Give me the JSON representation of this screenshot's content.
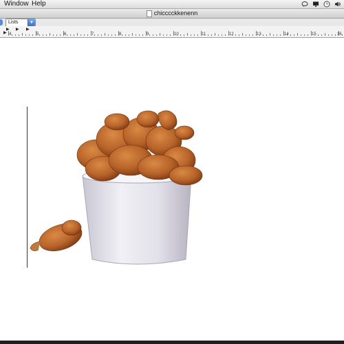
{
  "menubar": {
    "items": [
      "Window",
      "Help"
    ],
    "extras": [
      "bubble-icon",
      "display-icon",
      "clock-icon",
      "volume-icon"
    ]
  },
  "window": {
    "title": "chicccckkenenn"
  },
  "toolbar": {
    "list_style": "Lists"
  },
  "ruler": {
    "labels": [
      "4",
      "5",
      "6",
      "7",
      "8",
      "9",
      "10",
      "11",
      "12",
      "13",
      "14",
      "15",
      "16"
    ],
    "tab_stops": [
      "▶",
      "▶",
      "▶",
      "▶"
    ]
  },
  "document": {
    "image": "fried chicken bucket with a drumstick beside it"
  },
  "colors": {
    "accent": "#3d6fc9",
    "bucket": "#e8e6ee",
    "chicken": "#b8632a"
  }
}
